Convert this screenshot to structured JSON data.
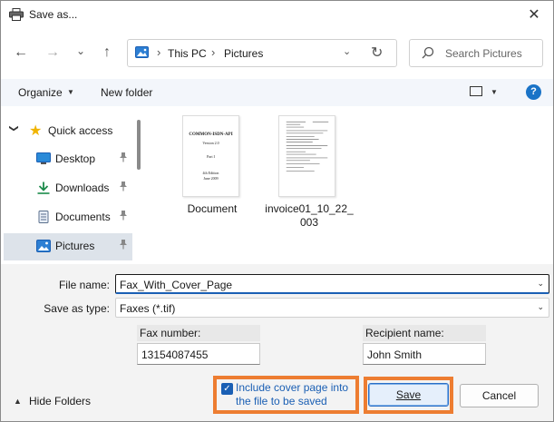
{
  "window": {
    "title": "Save as...",
    "close_glyph": "✕"
  },
  "nav": {
    "back_glyph": "←",
    "forward_glyph": "→",
    "recent_glyph": "⌄",
    "up_glyph": "↑",
    "breadcrumb": [
      "This PC",
      "Pictures"
    ],
    "breadcrumb_sep": "›",
    "refresh_glyph": "↻",
    "dropdown_glyph": "⌄"
  },
  "search": {
    "placeholder": "Search Pictures"
  },
  "toolbar": {
    "organize_label": "Organize",
    "new_folder_label": "New folder",
    "help_label": "?",
    "chev": "▼"
  },
  "sidebar": {
    "quick_access_label": "Quick access",
    "expand_glyph": "❯",
    "star_glyph": "★",
    "pin_glyph": "📌",
    "items": [
      {
        "label": "Desktop",
        "icon": "desktop-icon"
      },
      {
        "label": "Downloads",
        "icon": "download-icon"
      },
      {
        "label": "Documents",
        "icon": "documents-icon"
      },
      {
        "label": "Pictures",
        "icon": "pictures-icon",
        "selected": true
      }
    ]
  },
  "files": [
    {
      "name": "Document",
      "thumb_title": "COMMON-ISDN-API",
      "thumb_sub": "Version 2.0",
      "thumb_part": "Part I",
      "thumb_edition": "4th Edition",
      "thumb_date": "June 2009"
    },
    {
      "name_line1": "invoice01_10_22_",
      "name_line2": "003"
    }
  ],
  "form": {
    "file_name_label": "File name:",
    "file_name_value": "Fax_With_Cover_Page",
    "save_as_type_label": "Save as type:",
    "save_as_type_value": "Faxes (*.tif)",
    "fax_number_label": "Fax number:",
    "fax_number_value": "13154087455",
    "recipient_label": "Recipient name:",
    "recipient_value": "John Smith",
    "chev": "⌄"
  },
  "footer": {
    "hide_folders_label": "Hide Folders",
    "hide_glyph": "▲",
    "cover_page_line1": "Include cover page into",
    "cover_page_line2": "the file to be saved",
    "cover_checked_glyph": "✓",
    "save_label": "Save",
    "cancel_label": "Cancel"
  },
  "colors": {
    "highlight": "#ed7d31",
    "accent": "#1a5fb4",
    "selected_bg": "#dde3ea"
  }
}
